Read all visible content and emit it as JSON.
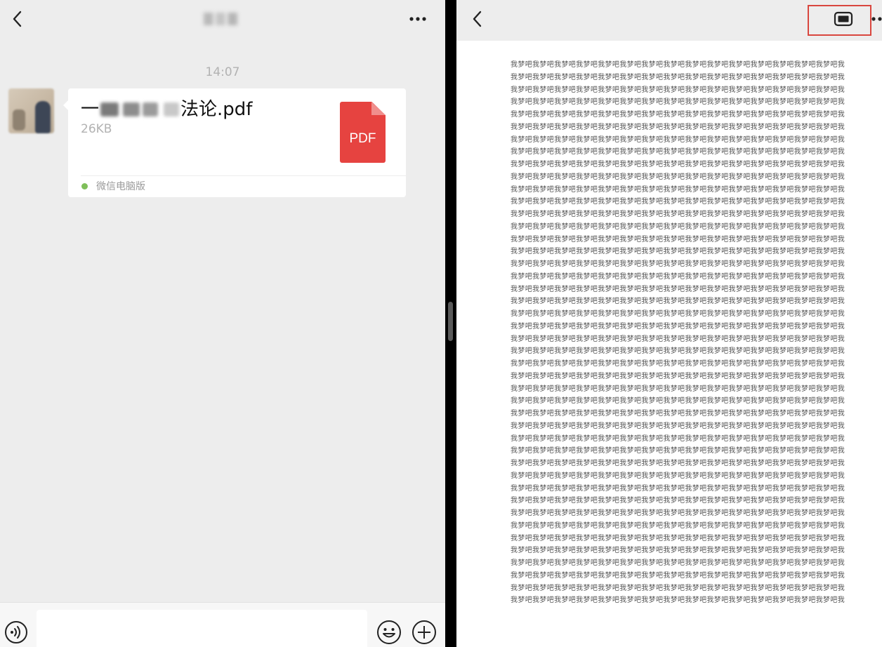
{
  "left_pane": {
    "timestamp": "14:07",
    "message": {
      "title_prefix": "一",
      "title_suffix": "法论.pdf",
      "size": "26KB",
      "file_icon_label": "PDF",
      "source": "微信电脑版"
    },
    "icons": {
      "back": "chevron-left-icon",
      "more": "more-dots-icon",
      "voice": "voice-icon",
      "emoji": "emoji-icon",
      "plus": "plus-icon"
    }
  },
  "right_pane": {
    "page_text_unit": "我梦吧",
    "icons": {
      "back": "chevron-left-icon",
      "screen": "screen-icon",
      "more": "more-dots-icon"
    }
  },
  "colors": {
    "pdf_icon": "#e64340",
    "highlight_border": "#d9463e",
    "chat_background": "#ededed"
  }
}
